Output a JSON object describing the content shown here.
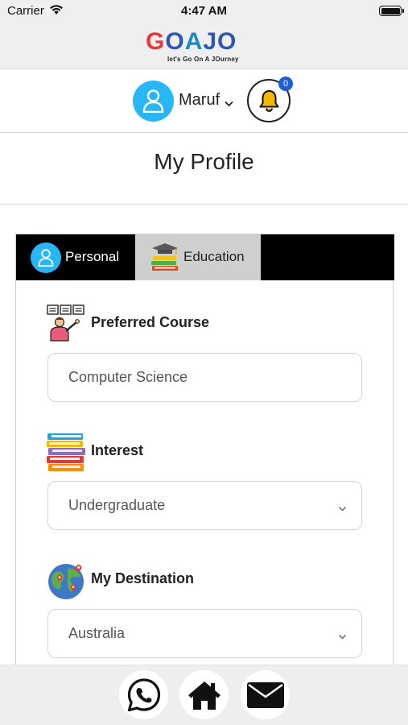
{
  "status_bar": {
    "carrier": "Carrier",
    "time": "4:47 AM"
  },
  "logo": {
    "parts": [
      "G",
      "O",
      "A",
      "J",
      "O"
    ],
    "tagline": "let's Go On A JOurney"
  },
  "user": {
    "name": "Maruf",
    "notification_count": "0"
  },
  "page": {
    "title": "My Profile"
  },
  "tabs": [
    {
      "label": "Personal",
      "active": false
    },
    {
      "label": "Education",
      "active": true
    }
  ],
  "form": {
    "preferred_course": {
      "label": "Preferred Course",
      "value": "Computer Science"
    },
    "interest": {
      "label": "Interest",
      "value": "Undergraduate"
    },
    "destination": {
      "label": "My Destination",
      "value": "Australia"
    }
  },
  "bottom_nav": [
    "whatsapp-icon",
    "home-icon",
    "mail-icon"
  ],
  "colors": {
    "accent_blue": "#29b6f6",
    "badge_blue": "#1e5fd6",
    "bell_yellow": "#f5b800",
    "tab_bar": "#000000",
    "tab_active": "#cfcfcf"
  }
}
